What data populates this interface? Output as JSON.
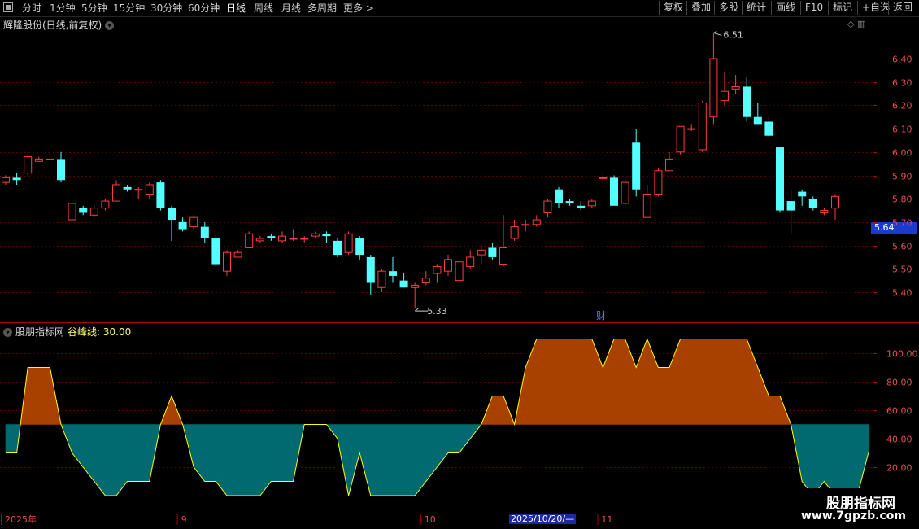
{
  "toolbar": {
    "periods": [
      "分时",
      "1分钟",
      "5分钟",
      "15分钟",
      "30分钟",
      "60分钟",
      "日线",
      "周线",
      "月线",
      "多周期",
      "更多 >"
    ],
    "active_period": "日线",
    "right_buttons": [
      "复权",
      "叠加",
      "多股",
      "统计",
      "画线",
      "F10",
      "标记",
      "+自选",
      "返回"
    ]
  },
  "chart": {
    "title": "辉隆股份(日线,前复权)",
    "high_label": "6.51",
    "low_label": "5.33",
    "current_price": "5.64",
    "event_marker": "财",
    "price_ticks": [
      "6.40",
      "6.30",
      "6.20",
      "6.10",
      "6.00",
      "5.90",
      "5.80",
      "5.70",
      "5.60",
      "5.50",
      "5.40"
    ],
    "candles": [
      [
        5.87,
        5.89,
        5.86,
        5.9
      ],
      [
        5.89,
        5.88,
        5.86,
        5.91
      ],
      [
        5.91,
        5.98,
        5.9,
        5.99
      ],
      [
        5.96,
        5.97,
        5.96,
        5.98
      ],
      [
        5.97,
        5.97,
        5.96,
        5.98
      ],
      [
        5.97,
        5.88,
        5.87,
        6.0
      ],
      [
        5.71,
        5.78,
        5.71,
        5.79
      ],
      [
        5.76,
        5.74,
        5.73,
        5.77
      ],
      [
        5.73,
        5.76,
        5.72,
        5.77
      ],
      [
        5.76,
        5.79,
        5.75,
        5.8
      ],
      [
        5.79,
        5.86,
        5.79,
        5.88
      ],
      [
        5.85,
        5.84,
        5.83,
        5.86
      ],
      [
        5.84,
        5.84,
        5.8,
        5.85
      ],
      [
        5.82,
        5.86,
        5.8,
        5.87
      ],
      [
        5.87,
        5.76,
        5.75,
        5.88
      ],
      [
        5.76,
        5.71,
        5.62,
        5.77
      ],
      [
        5.7,
        5.67,
        5.66,
        5.72
      ],
      [
        5.68,
        5.72,
        5.67,
        5.73
      ],
      [
        5.68,
        5.63,
        5.61,
        5.7
      ],
      [
        5.63,
        5.52,
        5.51,
        5.65
      ],
      [
        5.49,
        5.57,
        5.47,
        5.58
      ],
      [
        5.55,
        5.57,
        5.55,
        5.58
      ],
      [
        5.59,
        5.65,
        5.59,
        5.66
      ],
      [
        5.62,
        5.63,
        5.61,
        5.64
      ],
      [
        5.64,
        5.63,
        5.62,
        5.65
      ],
      [
        5.62,
        5.64,
        5.61,
        5.66
      ],
      [
        5.63,
        5.63,
        5.62,
        5.67
      ],
      [
        5.63,
        5.63,
        5.61,
        5.64
      ],
      [
        5.64,
        5.65,
        5.63,
        5.66
      ],
      [
        5.65,
        5.64,
        5.61,
        5.66
      ],
      [
        5.62,
        5.56,
        5.55,
        5.63
      ],
      [
        5.57,
        5.65,
        5.56,
        5.66
      ],
      [
        5.63,
        5.56,
        5.54,
        5.64
      ],
      [
        5.55,
        5.44,
        5.39,
        5.56
      ],
      [
        5.42,
        5.49,
        5.4,
        5.5
      ],
      [
        5.49,
        5.47,
        5.44,
        5.55
      ],
      [
        5.45,
        5.42,
        5.42,
        5.48
      ],
      [
        5.42,
        5.43,
        5.33,
        5.44
      ],
      [
        5.44,
        5.46,
        5.43,
        5.49
      ],
      [
        5.48,
        5.51,
        5.44,
        5.52
      ],
      [
        5.49,
        5.54,
        5.47,
        5.56
      ],
      [
        5.45,
        5.53,
        5.44,
        5.54
      ],
      [
        5.51,
        5.55,
        5.5,
        5.58
      ],
      [
        5.56,
        5.58,
        5.52,
        5.6
      ],
      [
        5.59,
        5.55,
        5.54,
        5.61
      ],
      [
        5.52,
        5.59,
        5.51,
        5.73
      ],
      [
        5.63,
        5.68,
        5.62,
        5.71
      ],
      [
        5.69,
        5.69,
        5.66,
        5.71
      ],
      [
        5.69,
        5.71,
        5.68,
        5.73
      ],
      [
        5.74,
        5.79,
        5.72,
        5.8
      ],
      [
        5.84,
        5.78,
        5.76,
        5.85
      ],
      [
        5.79,
        5.78,
        5.77,
        5.8
      ],
      [
        5.77,
        5.76,
        5.75,
        5.79
      ],
      [
        5.77,
        5.79,
        5.76,
        5.8
      ],
      [
        5.89,
        5.89,
        5.86,
        5.91
      ],
      [
        5.89,
        5.77,
        5.77,
        5.9
      ],
      [
        5.78,
        5.87,
        5.76,
        5.89
      ],
      [
        6.04,
        5.84,
        5.81,
        6.1
      ],
      [
        5.72,
        5.82,
        5.72,
        5.86
      ],
      [
        5.82,
        5.92,
        5.81,
        5.93
      ],
      [
        5.92,
        5.97,
        5.92,
        6.0
      ],
      [
        6.0,
        6.11,
        5.99,
        6.11
      ],
      [
        6.1,
        6.1,
        6.09,
        6.12
      ],
      [
        6.01,
        6.21,
        6.0,
        6.22
      ],
      [
        6.15,
        6.4,
        6.12,
        6.51
      ],
      [
        6.22,
        6.26,
        6.2,
        6.34
      ],
      [
        6.27,
        6.28,
        6.25,
        6.33
      ],
      [
        6.28,
        6.15,
        6.13,
        6.32
      ],
      [
        6.15,
        6.12,
        6.12,
        6.21
      ],
      [
        6.13,
        6.07,
        6.06,
        6.15
      ],
      [
        6.02,
        5.75,
        5.74,
        6.02
      ],
      [
        5.79,
        5.75,
        5.65,
        5.84
      ],
      [
        5.83,
        5.81,
        5.77,
        5.84
      ],
      [
        5.8,
        5.76,
        5.75,
        5.81
      ],
      [
        5.74,
        5.75,
        5.73,
        5.76
      ],
      [
        5.76,
        5.81,
        5.71,
        5.82
      ]
    ],
    "indicator": {
      "name": "股朋指标网",
      "line_label": "谷峰线: 30.00",
      "ticks": [
        "100.00",
        "80.00",
        "60.00",
        "40.00",
        "20.00"
      ],
      "baseline": 50,
      "values": [
        30,
        30,
        90,
        90,
        90,
        50,
        30,
        20,
        10,
        0,
        0,
        10,
        10,
        10,
        50,
        70,
        50,
        20,
        10,
        10,
        0,
        0,
        0,
        0,
        10,
        10,
        10,
        50,
        50,
        50,
        40,
        0,
        30,
        0,
        0,
        0,
        0,
        0,
        10,
        20,
        30,
        30,
        40,
        50,
        70,
        70,
        50,
        90,
        110,
        110,
        110,
        110,
        110,
        110,
        90,
        110,
        110,
        90,
        110,
        90,
        90,
        110,
        110,
        110,
        110,
        110,
        110,
        110,
        90,
        70,
        70,
        50,
        10,
        0,
        10,
        0,
        0,
        0,
        30
      ]
    },
    "x_labels": [
      {
        "text": "2025年",
        "i": 0
      },
      {
        "text": "9",
        "i": 16
      },
      {
        "text": "10",
        "i": 38
      },
      {
        "text": "11",
        "i": 54
      }
    ],
    "date_box": "2025/10/20/—"
  },
  "watermark": {
    "line1": "股朋指标网",
    "line2": "www.7gpzb.com"
  },
  "colors": {
    "up": "#ff3c3c",
    "down": "#54ffff",
    "grid": "#5a0000",
    "axis": "#b00000",
    "label": "#e05050",
    "fill_up": "#a84000",
    "fill_down": "#006a70",
    "line": "#ffff00"
  }
}
